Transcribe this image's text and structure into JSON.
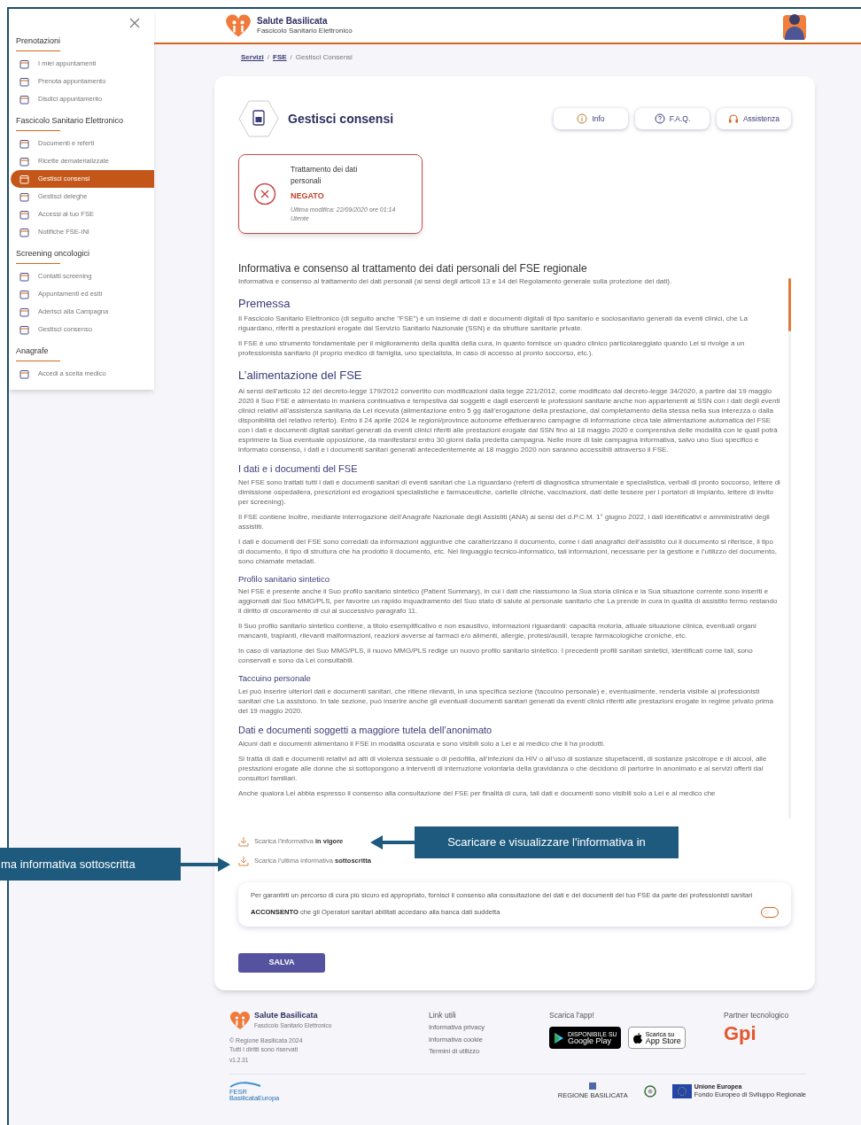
{
  "sidebar": {
    "sections": [
      {
        "title": "Prenotazioni",
        "items": [
          {
            "label": "I miei appuntamenti",
            "selected": false
          },
          {
            "label": "Prenota appuntamento",
            "selected": false
          },
          {
            "label": "Disdici appuntamento",
            "selected": false
          }
        ]
      },
      {
        "title": "Fascicolo Sanitario Elettronico",
        "items": [
          {
            "label": "Documenti e referti",
            "selected": false
          },
          {
            "label": "Ricette dematerializzate",
            "selected": false
          },
          {
            "label": "Gestisci consensi",
            "selected": true
          },
          {
            "label": "Gestisci deleghe",
            "selected": false
          },
          {
            "label": "Accessi al tuo FSE",
            "selected": false
          },
          {
            "label": "Notifiche FSE-INI",
            "selected": false
          }
        ]
      },
      {
        "title": "Screening oncologici",
        "items": [
          {
            "label": "Contatti screening",
            "selected": false
          },
          {
            "label": "Appuntamenti ed esiti",
            "selected": false
          },
          {
            "label": "Aderisci alla Campagna",
            "selected": false
          },
          {
            "label": "Gestisci consenso",
            "selected": false
          }
        ]
      },
      {
        "title": "Anagrafe",
        "items": [
          {
            "label": "Accedi a scelta medico",
            "selected": false
          }
        ]
      }
    ]
  },
  "header": {
    "brand": "Salute Basilicata",
    "subtitle": "Fascicolo Sanitario Elettronico"
  },
  "breadcrumb": {
    "separator": "/",
    "items": [
      {
        "label": "Servizi",
        "link": true
      },
      {
        "label": "FSE",
        "link": true
      },
      {
        "label": "Gestisci Consensi",
        "link": false
      }
    ]
  },
  "page": {
    "title": "Gestisci consensi",
    "buttons": [
      {
        "label": "Info",
        "kind": "info"
      },
      {
        "label": "F.A.Q.",
        "kind": "faq"
      },
      {
        "label": "Assistenza",
        "kind": "support"
      }
    ]
  },
  "status_card": {
    "title": "Trattamento dei dati personali",
    "status": "NEGATO",
    "granted": false,
    "modified": "Ultima modifica: 22/09/2020 ore 01:14",
    "by": "Utente"
  },
  "informativa": {
    "title": "Informativa e consenso al trattamento dei dati personali del FSE regionale",
    "blocks": [
      {
        "kind": "p",
        "text": "Informativa e consenso al trattamento dei dati personali (ai sensi degli articoli 13 e 14 del Regolamento generale sulla protezione dei dati)."
      },
      {
        "kind": "h2",
        "text": "Premessa"
      },
      {
        "kind": "p",
        "text": "Il Fascicolo Sanitario Elettronico (di seguito anche \"FSE\") è un insieme di dati e documenti digitali di tipo sanitario e sociosanitario generati da eventi clinici, che La riguardano, riferiti a prestazioni erogate dal Servizio Sanitario Nazionale (SSN) e da strutture sanitarie private."
      },
      {
        "kind": "p",
        "text": "Il FSE è uno strumento fondamentale per il miglioramento della qualità della cura, in quanto fornisce un quadro clinico particolareggiato quando Lei si rivolge a un professionista sanitario (il proprio medico di famiglia, uno specialista, in caso di accesso al pronto soccorso, etc.)."
      },
      {
        "kind": "h2",
        "text": "L’alimentazione del FSE"
      },
      {
        "kind": "p",
        "text": "Ai sensi dell’articolo 12 del decreto-legge 179/2012 convertito con modificazioni dalla legge 221/2012, come modificato dal decreto-legge 34/2020, a partire dal 19 maggio 2020 il Suo FSE è alimentato in maniera continuativa e tempestiva dai soggetti e dagli esercenti le professioni sanitarie anche non appartenenti al SSN con i dati degli eventi clinici relativi all’assistenza sanitaria da Lei ricevuta (alimentazione entro 5 gg dall’erogazione della prestazione, dal completamento della stessa nella sua interezza o dalla disponibilità del relativo referto). Entro il 24 aprile 2024 le regioni/province autonome effettueranno campagne di informazione circa tale alimentazione automatica del FSE con i dati e documenti digitali sanitari generati da eventi clinici riferiti alle prestazioni erogate dal SSN fino al 18 maggio 2020 e comprensiva delle modalità con le quali potrà esprimere la Sua eventuale opposizione, da manifestarsi entro 30 giorni dalla predetta campagna. Nelle more di tale campagna informativa, salvo uno Suo specifico e informato consenso, i dati e i documenti sanitari generati antecedentemente al 18 maggio 2020 non saranno accessibili attraverso il FSE."
      },
      {
        "kind": "h3",
        "text": "I dati e i documenti del FSE"
      },
      {
        "kind": "p",
        "text": "Nel FSE sono trattati tutti i dati e documenti sanitari di eventi sanitari che La riguardano (referti di diagnostica strumentale e specialistica, verbali di pronto soccorso, lettere di dimissione ospedaliera, prescrizioni ed erogazioni specialistiche e farmaceutiche, cartelle cliniche, vaccinazioni, dati delle tessere per i portatori di impianto, lettere di invito per screening)."
      },
      {
        "kind": "p",
        "text": "Il FSE contiene inoltre, mediante interrogazione dell’Anagrafe Nazionale degli Assistiti (ANA) ai sensi del d.P.C.M. 1° giugno 2022, i dati identificativi e amministrativi degli assistiti."
      },
      {
        "kind": "p",
        "text": "I dati e documenti del FSE sono corredati da informazioni aggiuntive che caratterizzano il documento, come i dati anagrafici dell’assistito cui il documento si riferisce, il tipo di documento, il tipo di struttura che ha prodotto il documento, etc. Nel linguaggio tecnico-informatico, tali informazioni, necessarie per la gestione e l’utilizzo del documento, sono chiamate metadati."
      },
      {
        "kind": "h4",
        "text": "Profilo sanitario sintetico"
      },
      {
        "kind": "p",
        "text": "Nel FSE è presente anche il Suo profilo sanitario sintetico (Patient Summary), in cui i dati che riassumono la Sua storia clinica e la Sua situazione corrente sono inseriti e aggiornati dal Suo MMG/PLS, per favorire un rapido inquadramento del Suo stato di salute al personale sanitario che La prende in cura in qualità di assistito fermo restando il diritto di oscuramento di cui al successivo paragrafo 11."
      },
      {
        "kind": "p",
        "text": "Il Suo profilo sanitario sintetico contiene, a titolo esemplificativo e non esaustivo, informazioni riguardanti: capacità motoria, attuale situazione clinica, eventuali organi mancanti, trapianti, rilevanti malformazioni, reazioni avverse ai farmaci e/o alimenti, allergie, protesi/ausili, terapie farmacologiche croniche, etc."
      },
      {
        "kind": "p",
        "text": "In caso di variazione del Suo MMG/PLS, il nuovo MMG/PLS redige un nuovo profilo sanitario sintetico. I precedenti profili sanitari sintetici, identificati come tali, sono conservati e sono da Lei consultabili."
      },
      {
        "kind": "h4",
        "text": "Taccuino personale"
      },
      {
        "kind": "p",
        "text": "Lei può inserire ulteriori dati e documenti sanitari, che ritiene rilevanti, in una specifica sezione (taccuino personale) e, eventualmente, renderla visibile ai professionisti sanitari che La assistono. In tale sezione, può inserire anche gli eventuali documenti sanitari generati da eventi clinici riferiti alle prestazioni erogate in regime privato prima del 19 maggio 2020."
      },
      {
        "kind": "h3",
        "text": "Dati e documenti soggetti a maggiore tutela dell’anonimato"
      },
      {
        "kind": "p",
        "text": "Alcuni dati e documenti alimentano il FSE in modalità oscurata e sono visibili solo a Lei e al medico che li ha prodotti."
      },
      {
        "kind": "p",
        "text": "Si tratta di dati e documenti relativi ad atti di violenza sessuale o di pedofilia, all’infezioni da HIV o all’uso di sostanze stupefacenti, di sostanze psicotrope e di alcool, alle prestazioni erogate alle donne che si sottopongono a interventi di interruzione volontaria della gravidanza o che decidono di partorire in anonimato e ai servizi offerti dai consultori familiari."
      },
      {
        "kind": "p",
        "text": "Anche qualora Lei abbia espresso il consenso alla consultazione del FSE per finalità di cura, tali dati e documenti sono visibili solo a Lei e al medico che"
      }
    ]
  },
  "downloads": [
    "Scarica l'informativa **in vigore**",
    "Scarica l'ultima informativa **sottoscritta**"
  ],
  "consent": {
    "text": "Per garantirti un percorso di cura più sicuro ed appropriato, fornisci il consenso alla consultazione dei dati e dei documenti del tuo FSE da parte dei professionisti sanitari",
    "label": "**ACCONSENTO** che gli Operatori sanitari abilitati accedano alla banca dati suddetta",
    "on": false
  },
  "save_button": "SALVA",
  "footer": {
    "brand": "Salute Basilicata",
    "subtitle": "Fascicolo Sanitario Elettronico",
    "legal": [
      "© Regione Basilicata 2024",
      "Tutti i diritti sono riservati",
      "v1.2.31"
    ],
    "links_title": "Link utili",
    "links": [
      "Informativa privacy",
      "Informativa cookie",
      "Termini di utilizzo"
    ],
    "app_title": "Scarica l'app!",
    "stores": [
      {
        "kind": "google",
        "small": "DISPONIBILE SU",
        "name": "Google Play"
      },
      {
        "kind": "apple",
        "small": "Scarica su",
        "name": "App Store"
      }
    ],
    "partner_title": "Partner tecnologico",
    "partner": "Gpi",
    "logos": {
      "fesr": "FESR",
      "fesr_sub": "BasilicataEuropa",
      "region": "REGIONE BASILICATA",
      "eu": "Unione Europea",
      "eu_sub": "Fondo Europeo di Sviluppo Regionale"
    }
  },
  "callouts": [
    {
      "text": "Scaricare e visualizzare l'informativa in"
    },
    {
      "text": "ma informativa sottoscritta"
    }
  ]
}
